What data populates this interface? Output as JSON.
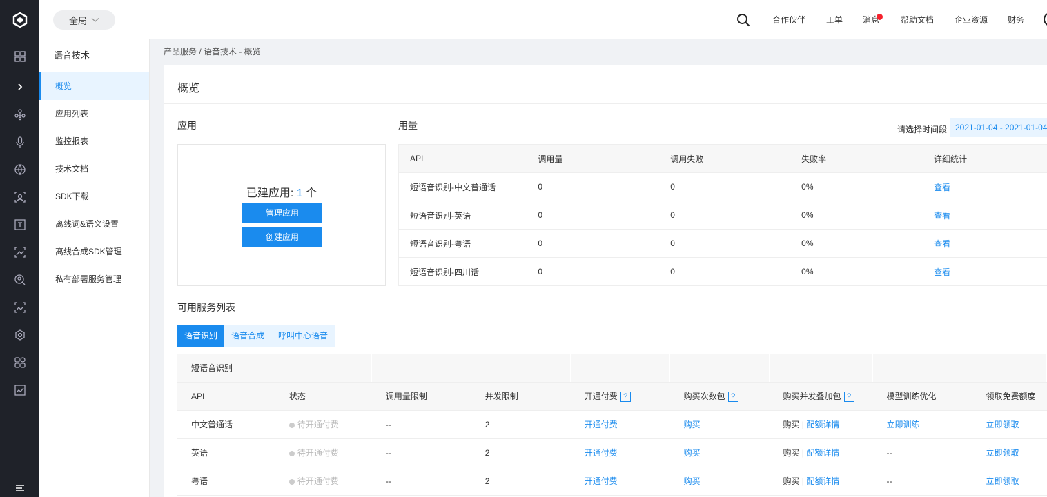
{
  "topbar": {
    "scope_label": "全局",
    "nav": [
      "合作伙伴",
      "工单",
      "消息",
      "帮助文档",
      "企业资源",
      "财务"
    ]
  },
  "side": {
    "title": "语音技术",
    "items": [
      "概览",
      "应用列表",
      "监控报表",
      "技术文档",
      "SDK下载",
      "离线词&语义设置",
      "离线合成SDK管理",
      "私有部署服务管理"
    ],
    "active_index": 0
  },
  "breadcrumb": "产品服务 / 语音技术 - 概览",
  "page_title": "概览",
  "apps": {
    "title": "应用",
    "count_label": "已建应用: ",
    "count": "1",
    "count_unit": " 个",
    "manage_label": "管理应用",
    "create_label": "创建应用"
  },
  "usage": {
    "title": "用量",
    "range_label": "请选择时间段",
    "range_value": "2021-01-04 - 2021-01-04",
    "headers": [
      "API",
      "调用量",
      "调用失败",
      "失败率",
      "详细统计"
    ],
    "rows": [
      [
        "短语音识别-中文普通话",
        "0",
        "0",
        "0%",
        "查看"
      ],
      [
        "短语音识别-英语",
        "0",
        "0",
        "0%",
        "查看"
      ],
      [
        "短语音识别-粤语",
        "0",
        "0",
        "0%",
        "查看"
      ],
      [
        "短语音识别-四川话",
        "0",
        "0",
        "0%",
        "查看"
      ]
    ]
  },
  "services": {
    "title": "可用服务列表",
    "tabs": [
      "语音识别",
      "语音合成",
      "呼叫中心语音"
    ],
    "group": "短语音识别",
    "headers": [
      "API",
      "状态",
      "调用量限制",
      "并发限制",
      "开通付费",
      "购买次数包",
      "购买并发叠加包",
      "模型训练优化",
      "领取免费额度"
    ],
    "help_mark": "?",
    "rows": [
      {
        "api": "中文普通话",
        "status": "待开通付费",
        "limit": "--",
        "concurrency": "2",
        "pay": "开通付费",
        "buy": "购买",
        "buy_plain": "购买",
        "quota": "配额详情",
        "train": "立即训练",
        "free": "立即领取"
      },
      {
        "api": "英语",
        "status": "待开通付费",
        "limit": "--",
        "concurrency": "2",
        "pay": "开通付费",
        "buy": "购买",
        "buy_plain": "购买",
        "quota": "配额详情",
        "train": "--",
        "free": "立即领取"
      },
      {
        "api": "粤语",
        "status": "待开通付费",
        "limit": "--",
        "concurrency": "2",
        "pay": "开通付费",
        "buy": "购买",
        "buy_plain": "购买",
        "quota": "配额详情",
        "train": "--",
        "free": "立即领取"
      }
    ]
  },
  "colors": {
    "accent": "#1a8bee",
    "rail": "#1f2229",
    "alert": "#f5222d"
  }
}
